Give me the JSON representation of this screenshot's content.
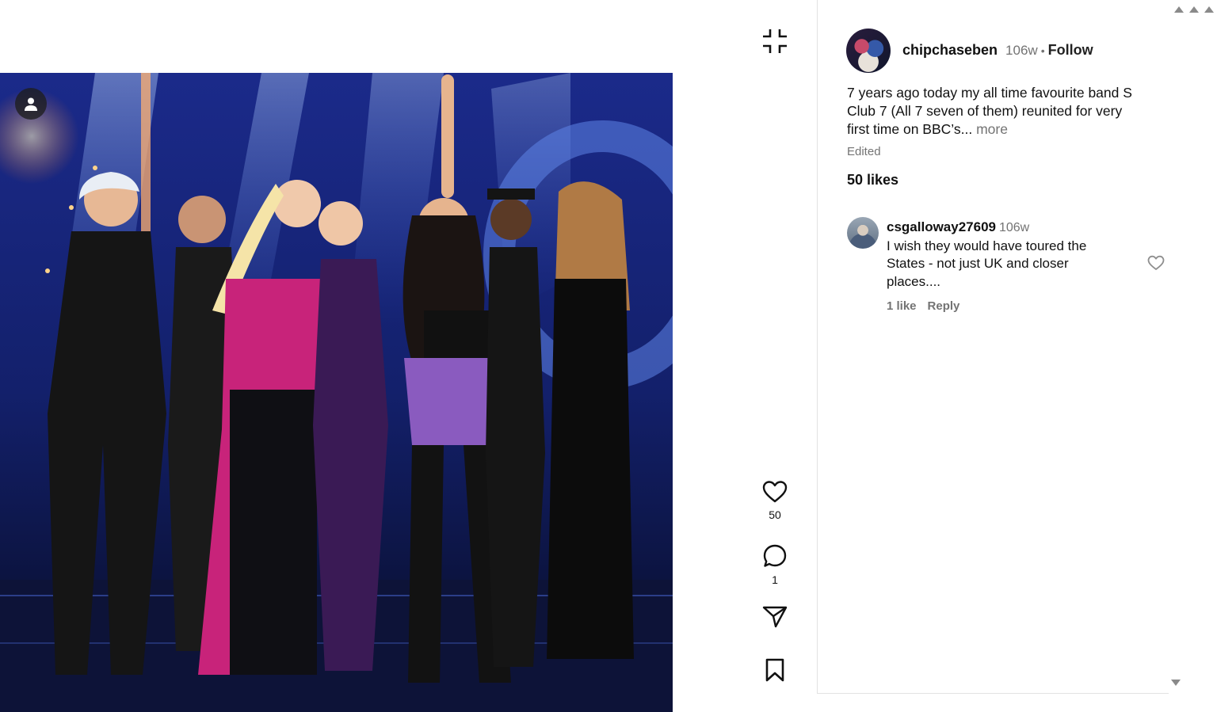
{
  "post": {
    "author": "chipchaseben",
    "age": "106w",
    "separator": "•",
    "follow_label": "Follow",
    "caption": "7 years ago today my all time favourite band S Club 7 (All 7 seven of them) reunited for very first time on BBC’s...",
    "more_label": "more",
    "edited_label": "Edited",
    "likes_label": "50 likes"
  },
  "rail": {
    "like_count": "50",
    "comment_count": "1"
  },
  "comments": [
    {
      "username": "csgalloway27609",
      "age": "106w",
      "text": "I wish they would have toured the States - not just UK and closer places....",
      "likes": "1 like",
      "reply_label": "Reply"
    }
  ],
  "icons": {
    "collapse": "collapse-icon",
    "like": "heart-icon",
    "comment": "comment-icon",
    "share": "send-icon",
    "save": "bookmark-icon",
    "tag": "user-tag-icon"
  }
}
